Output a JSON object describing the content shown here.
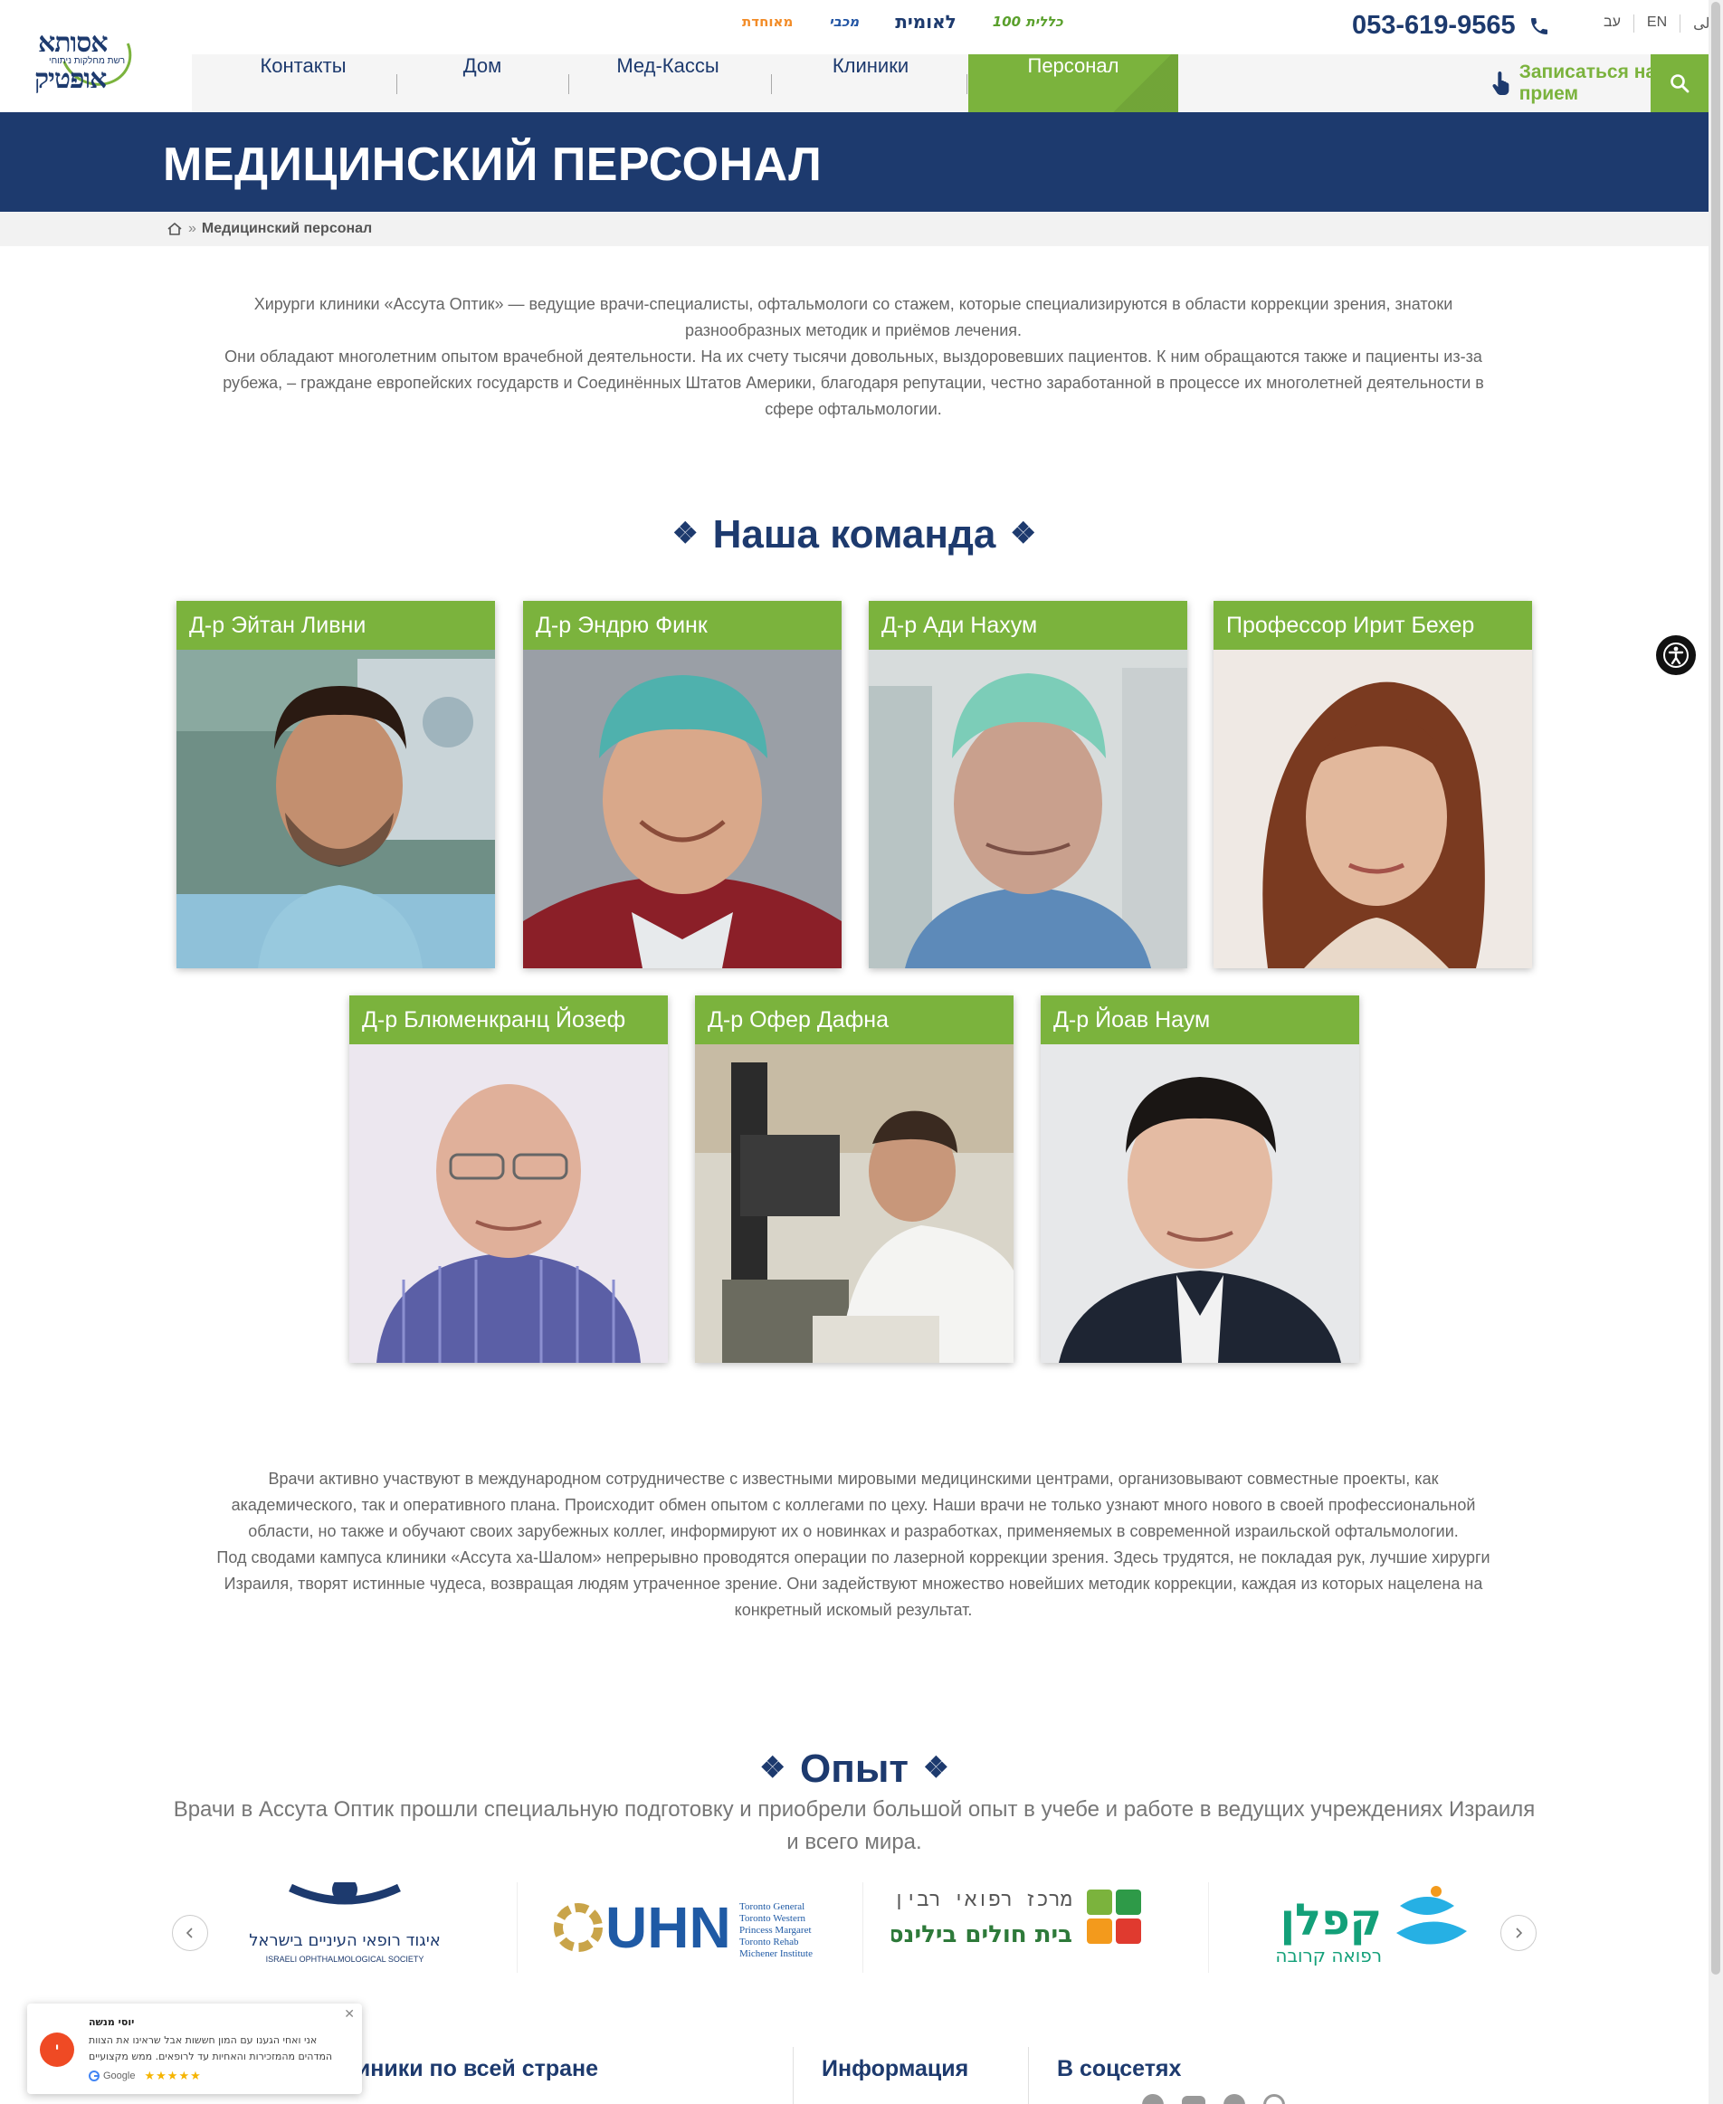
{
  "header": {
    "hmo_logos": [
      "מאוחדת",
      "מכבי",
      "לאומית",
      "כללית 100"
    ],
    "phone": "053-619-9565",
    "languages": [
      "الى",
      "EN",
      "עב"
    ],
    "logo_text_top": "אסותא",
    "logo_text_sub": "רשת מחלקות ניתוחי",
    "logo_text_bottom": "אופטיק"
  },
  "nav": {
    "items": [
      "Контакты",
      "Дом",
      "Мед-Кассы",
      "Клиники",
      "Персонал"
    ],
    "active": "Персонал",
    "appointment_label": "Записаться на прием"
  },
  "banner": {
    "title": "МЕДИЦИНСКИЙ ПЕРСОНАЛ"
  },
  "breadcrumb": {
    "separator": "»",
    "current": "Медицинский персонал"
  },
  "intro": {
    "p1": "Хирурги клиники «Ассута Оптик» — ведущие врачи-специалисты, офтальмологи со стажем, которые специализируются в области коррекции зрения, знатоки разнообразных методик и приёмов лечения.",
    "p2": "Они обладают многолетним опытом врачебной деятельности. На их счету тысячи довольных, выздоровевших пациентов. К ним обращаются также и пациенты из-за рубежа, – граждане европейских государств и Соединённых Штатов Америки, благодаря репутации, честно заработанной в процессе их многолетней деятельности в сфере офтальмологии."
  },
  "team": {
    "heading": "Наша команда",
    "ornament": "❖",
    "doctors": [
      "Д-р Эйтан Ливни",
      "Д-р Эндрю Финк",
      "Д-р Ади Нахум",
      "Профессор Ирит Бехер",
      "Д-р Блюменкранц Йозеф",
      "Д-р Офер Дафна",
      "Д-р Йоав Наум"
    ]
  },
  "cooperation": {
    "p1": "Врачи активно участвуют в международном сотрудничестве с известными мировыми медицинскими центрами, организовывают совместные проекты, как академического, так и оперативного плана. Происходит обмен опытом с коллегами по цеху. Наши врачи не только узнают много нового в своей профессиональной области, но также и обучают своих зарубежных коллег, информируют их о новинках и разработках, применяемых в современной израильской офтальмологии.",
    "p2": "Под сводами кампуса клиники «Ассута ха-Шалом» непрерывно проводятся операции по лазерной коррекции зрения. Здесь трудятся, не покладая рук, лучшие хирурги Израиля, творят истинные чудеса, возвращая людям утраченное зрение. Они задействуют множество новейших методик коррекции, каждая из которых нацелена на конкретный искомый результат."
  },
  "experience": {
    "heading": "Опыт",
    "subtitle": "Врачи в Ассута Оптик прошли специальную подготовку и приобрели большой опыт в учебе и работе в ведущих учреждениях Израиля и всего мира.",
    "partners": [
      {
        "name": "איגוד רופאי העיניים בישראל",
        "sub": "ISRAELI OPHTHALMOLOGICAL SOCIETY"
      },
      {
        "name": "UHN",
        "sub_lines": [
          "Toronto General",
          "Toronto Western",
          "Princess Margaret",
          "Toronto Rehab",
          "Michener Institute"
        ]
      },
      {
        "name": "מרכז רפואי רבין",
        "sub": "בית חולים בילינסון"
      },
      {
        "name": "קפלן",
        "sub": "רפואה קרובה"
      }
    ]
  },
  "footer": {
    "col1": "линики по всей стране",
    "col2": "Информация",
    "col3": "В соцсетях"
  },
  "review_widget": {
    "author": "יוסי מנשה",
    "avatar_letter": "י",
    "text": "אני ואחי הגענו עם המון חששות אבל שראינו את הצוות המדהים מהמזכירות והאחיות עד לרופאים. ממש מקצועיים וסבלניים, וכל הצוות המדהים שיש שם הבנו שאנחנו בידיים טובות",
    "source": "Google",
    "stars": "★★★★★"
  },
  "colors": {
    "navy": "#1d3a6e",
    "green": "#7bb33d"
  }
}
